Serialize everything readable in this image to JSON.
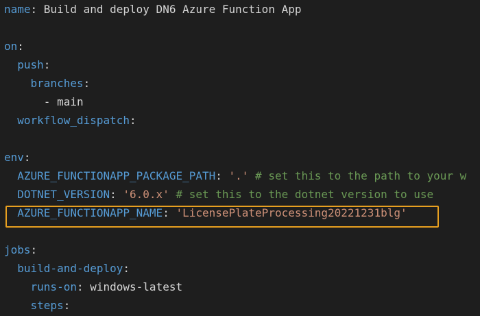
{
  "editor": {
    "highlight_color": "#e8a020",
    "colors": {
      "background": "#1e1e1e",
      "key": "#569cd6",
      "string": "#ce9178",
      "text": "#d4d4d4",
      "comment": "#6a9955"
    },
    "lines": {
      "l1_key": "name",
      "l1_sep": ": ",
      "l1_value": "Build and deploy DN6 Azure Function App",
      "l3_key": "on",
      "l3_sep": ":",
      "l4_indent": "  ",
      "l4_key": "push",
      "l4_sep": ":",
      "l5_indent": "    ",
      "l5_key": "branches",
      "l5_sep": ":",
      "l6_indent": "      ",
      "l6_value": "- main",
      "l7_indent": "  ",
      "l7_key": "workflow_dispatch",
      "l7_sep": ":",
      "l9_key": "env",
      "l9_sep": ":",
      "l10_indent": "  ",
      "l10_key": "AZURE_FUNCTIONAPP_PACKAGE_PATH",
      "l10_sep": ": ",
      "l10_value": "'.'",
      "l10_comment": " # set this to the path to your w",
      "l11_indent": "  ",
      "l11_key": "DOTNET_VERSION",
      "l11_sep": ": ",
      "l11_value": "'6.0.x'",
      "l11_comment": " # set this to the dotnet version to use",
      "l12_indent": "  ",
      "l12_key": "AZURE_FUNCTIONAPP_NAME",
      "l12_sep": ": ",
      "l12_value": "'LicensePlateProcessing20221231blg'",
      "l14_key": "jobs",
      "l14_sep": ":",
      "l15_indent": "  ",
      "l15_key": "build-and-deploy",
      "l15_sep": ":",
      "l16_indent": "    ",
      "l16_key": "runs-on",
      "l16_sep": ": ",
      "l16_value": "windows-latest",
      "l17_indent": "    ",
      "l17_key": "steps",
      "l17_sep": ":"
    }
  }
}
